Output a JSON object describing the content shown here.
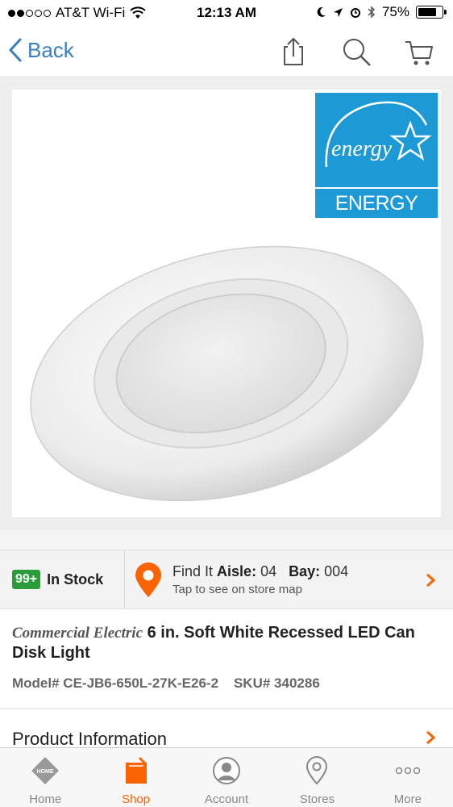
{
  "status_bar": {
    "carrier": "AT&T Wi-Fi",
    "time": "12:13 AM",
    "battery": "75%",
    "battery_level": 0.75
  },
  "nav": {
    "back_label": "Back",
    "icons": [
      "share-icon",
      "search-icon",
      "cart-icon"
    ]
  },
  "product_image": {
    "badge_label": "ENERGY STAR",
    "badge_script": "energy",
    "badge_color": "#1d9ad6"
  },
  "stock": {
    "badge": "99+",
    "label": "In Stock"
  },
  "find_it": {
    "prefix": "Find It",
    "aisle_label": "Aisle:",
    "aisle_value": "04",
    "bay_label": "Bay:",
    "bay_value": "004",
    "subtitle": "Tap to see on store map"
  },
  "product": {
    "brand": "Commercial Electric",
    "title": "6 in. Soft White Recessed LED Can Disk Light",
    "model_label": "Model#",
    "model_value": "CE-JB6-650L-27K-E26-2",
    "sku_label": "SKU#",
    "sku_value": "340286"
  },
  "sections": {
    "product_information": "Product Information"
  },
  "tabs": [
    {
      "label": "Home",
      "icon": "home-depot-logo-icon",
      "active": false
    },
    {
      "label": "Shop",
      "icon": "shop-icon",
      "active": true
    },
    {
      "label": "Account",
      "icon": "account-icon",
      "active": false
    },
    {
      "label": "Stores",
      "icon": "stores-pin-icon",
      "active": false
    },
    {
      "label": "More",
      "icon": "more-dots-icon",
      "active": false
    }
  ],
  "colors": {
    "accent": "#f96302",
    "link": "#3a7fc1",
    "stock_badge": "#2a9d3a"
  }
}
